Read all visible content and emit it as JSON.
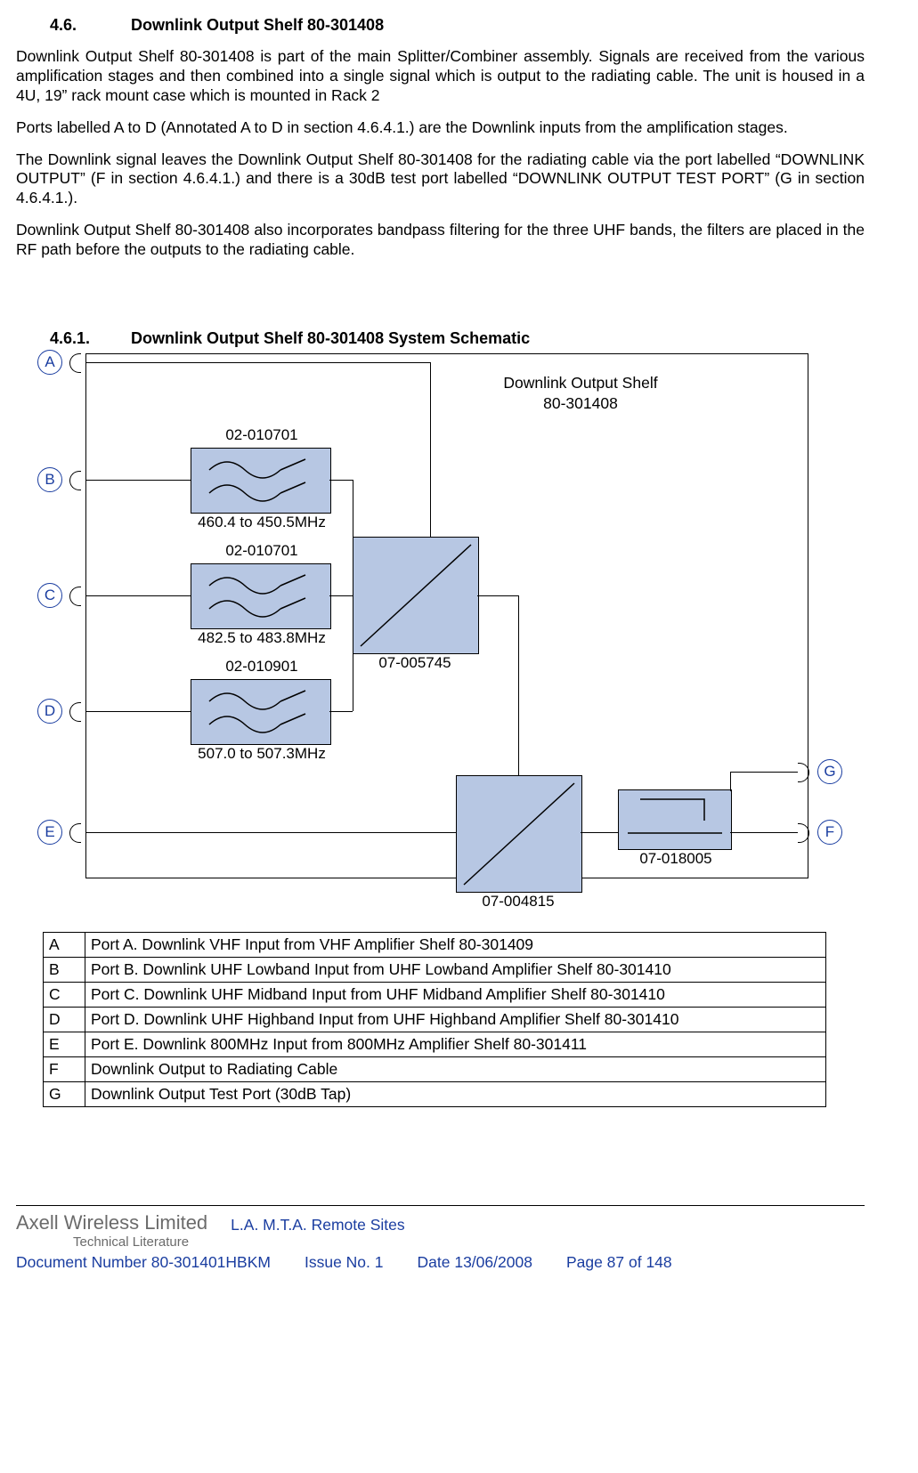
{
  "heading_46": {
    "num": "4.6.",
    "title": "Downlink Output Shelf 80-301408"
  },
  "para1": "Downlink Output Shelf 80-301408 is part of the main Splitter/Combiner assembly. Signals are received from the various amplification stages and then combined into a single signal which is output to the radiating cable. The unit is housed in a 4U, 19” rack mount case which is mounted in Rack 2",
  "para2": "Ports labelled A to D (Annotated A to D in section 4.6.4.1.) are the Downlink inputs from the amplification stages.",
  "para3": "The Downlink signal leaves the Downlink Output Shelf 80-301408 for the radiating cable via the port labelled “DOWNLINK OUTPUT” (F in section 4.6.4.1.) and there is a 30dB test port labelled “DOWNLINK OUTPUT TEST PORT” (G in section 4.6.4.1.).",
  "para4": "Downlink Output Shelf 80-301408 also incorporates bandpass filtering for the three UHF bands, the filters are placed in the RF path before the outputs to the radiating cable.",
  "heading_461": {
    "num": "4.6.1.",
    "title": "Downlink Output Shelf 80-301408 System Schematic"
  },
  "schematic": {
    "title_l1": "Downlink Output Shelf",
    "title_l2": "80-301408",
    "ports": {
      "a": "A",
      "b": "B",
      "c": "C",
      "d": "D",
      "e": "E",
      "f": "F",
      "g": "G"
    },
    "filter_b": {
      "top": "02-010701",
      "bot": "460.4 to 450.5MHz"
    },
    "filter_c": {
      "top": "02-010701",
      "bot": "482.5 to 483.8MHz"
    },
    "filter_d": {
      "top": "02-010901",
      "bot": "507.0 to 507.3MHz"
    },
    "combiner1": "07-005745",
    "combiner2": "07-004815",
    "coupler": "07-018005"
  },
  "legend": [
    {
      "k": "A",
      "v": "Port A. Downlink VHF Input from VHF Amplifier Shelf 80-301409"
    },
    {
      "k": "B",
      "v": "Port B. Downlink UHF Lowband Input from UHF Lowband Amplifier Shelf 80-301410"
    },
    {
      "k": "C",
      "v": "Port C. Downlink UHF Midband Input from UHF Midband Amplifier Shelf 80-301410"
    },
    {
      "k": "D",
      "v": "Port D. Downlink UHF Highband Input from UHF Highband Amplifier Shelf 80-301410"
    },
    {
      "k": "E",
      "v": "Port E. Downlink 800MHz Input from 800MHz Amplifier Shelf 80-301411"
    },
    {
      "k": "F",
      "v": "Downlink Output to Radiating Cable"
    },
    {
      "k": "G",
      "v": "Downlink Output Test Port (30dB Tap)"
    }
  ],
  "footer": {
    "brand": "Axell Wireless Limited",
    "tl": "Technical Literature",
    "sites": "L.A. M.T.A. Remote Sites",
    "doc": "Document Number 80-301401HBKM",
    "issue": "Issue No. 1",
    "date": "Date 13/06/2008",
    "page": "Page 87 of 148"
  }
}
